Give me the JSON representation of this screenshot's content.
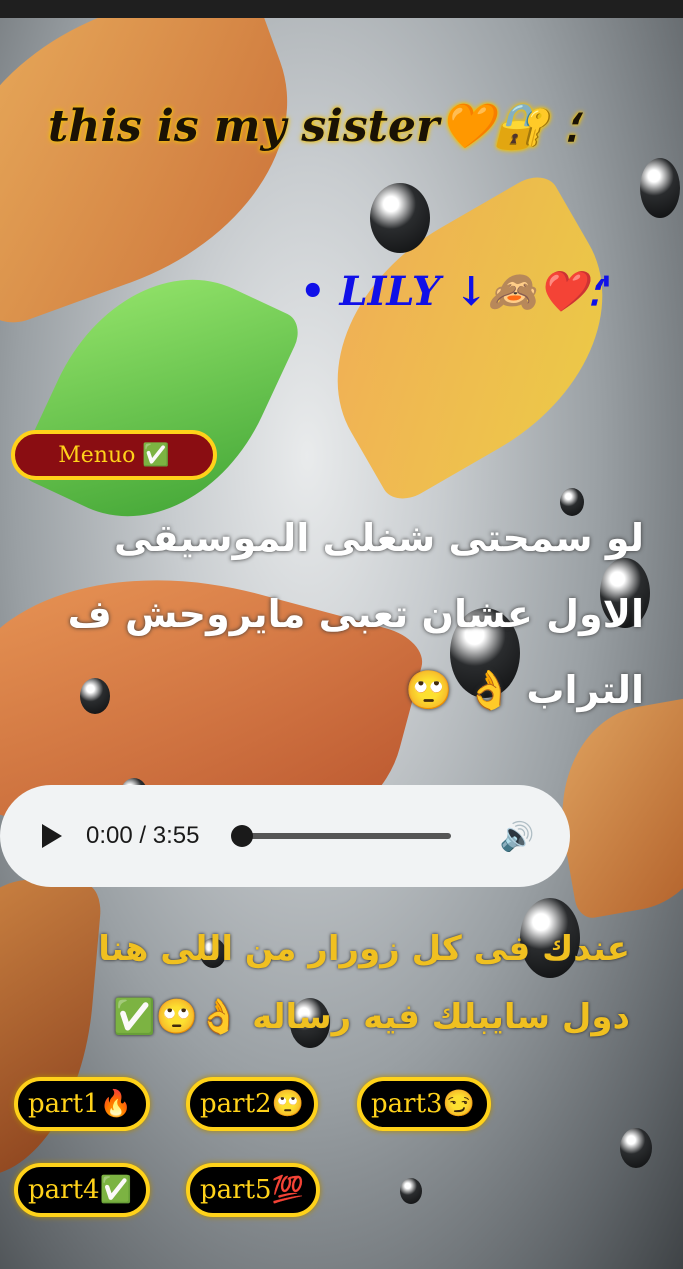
{
  "title": "this is my sister🧡🔐 ؛",
  "name_line": "• LILY ↓🙈❤️؛'",
  "menu_button": "Menuo ✅",
  "message1": "لو سمحتى شغلى الموسيقى الاول عشان تعبى مايروحش ف التراب 👌 🙄",
  "audio": {
    "current_time": "0:00",
    "separator": " / ",
    "duration": "3:55"
  },
  "message2": "عندك فى كل زورار من اللى هنا دول سايبلك فيه رساله 👌🙄✅",
  "parts": [
    "part1🔥",
    "part2🙄",
    "part3😏",
    "part4✅",
    "part5💯"
  ],
  "colors": {
    "accent": "#ffd21a",
    "menu_bg": "#8a0d12",
    "name": "#1010e8"
  }
}
